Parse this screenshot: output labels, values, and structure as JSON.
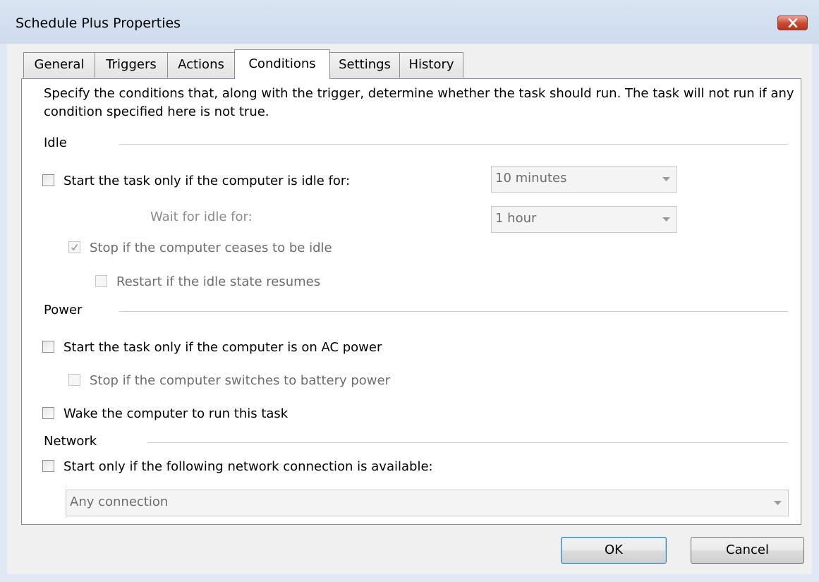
{
  "window": {
    "title": "Schedule Plus Properties"
  },
  "tabs": [
    {
      "label": "General"
    },
    {
      "label": "Triggers"
    },
    {
      "label": "Actions"
    },
    {
      "label": "Conditions"
    },
    {
      "label": "Settings"
    },
    {
      "label": "History"
    }
  ],
  "active_tab": "Conditions",
  "description": "Specify the conditions that, along with the trigger, determine whether the task should run.  The task will not run  if any condition specified here is not true.",
  "idle": {
    "heading": "Idle",
    "start_if_idle": {
      "label": "Start the task only if the computer is idle for:",
      "checked": false,
      "enabled": true
    },
    "idle_duration": {
      "value": "10  minutes",
      "enabled": false
    },
    "wait_label": "Wait for idle for:",
    "wait_duration": {
      "value": "1  hour",
      "enabled": false
    },
    "stop_if_not_idle": {
      "label": "Stop if the computer ceases to be idle",
      "checked": true,
      "enabled": false
    },
    "restart_if_idle": {
      "label": "Restart if the idle state resumes",
      "checked": false,
      "enabled": false
    }
  },
  "power": {
    "heading": "Power",
    "start_on_ac": {
      "label": "Start the task only if the computer is on AC power",
      "checked": false,
      "enabled": true
    },
    "stop_on_battery": {
      "label": "Stop if the computer switches to battery power",
      "checked": false,
      "enabled": false
    },
    "wake_to_run": {
      "label": "Wake the computer to run this task",
      "checked": false,
      "enabled": true
    }
  },
  "network": {
    "heading": "Network",
    "start_if_network": {
      "label": "Start only if the following network connection is available:",
      "checked": false,
      "enabled": true
    },
    "connection": {
      "value": "Any connection",
      "enabled": false
    }
  },
  "buttons": {
    "ok": "OK",
    "cancel": "Cancel"
  },
  "icons": {
    "close": "close-x-icon",
    "dropdown": "chevron-down-icon",
    "check": "checkmark-icon"
  },
  "colors": {
    "close_button": "#c9472f",
    "titlebar": "#d8e4f2",
    "panel": "#ffffff",
    "disabled_text": "#6d6d6d"
  }
}
